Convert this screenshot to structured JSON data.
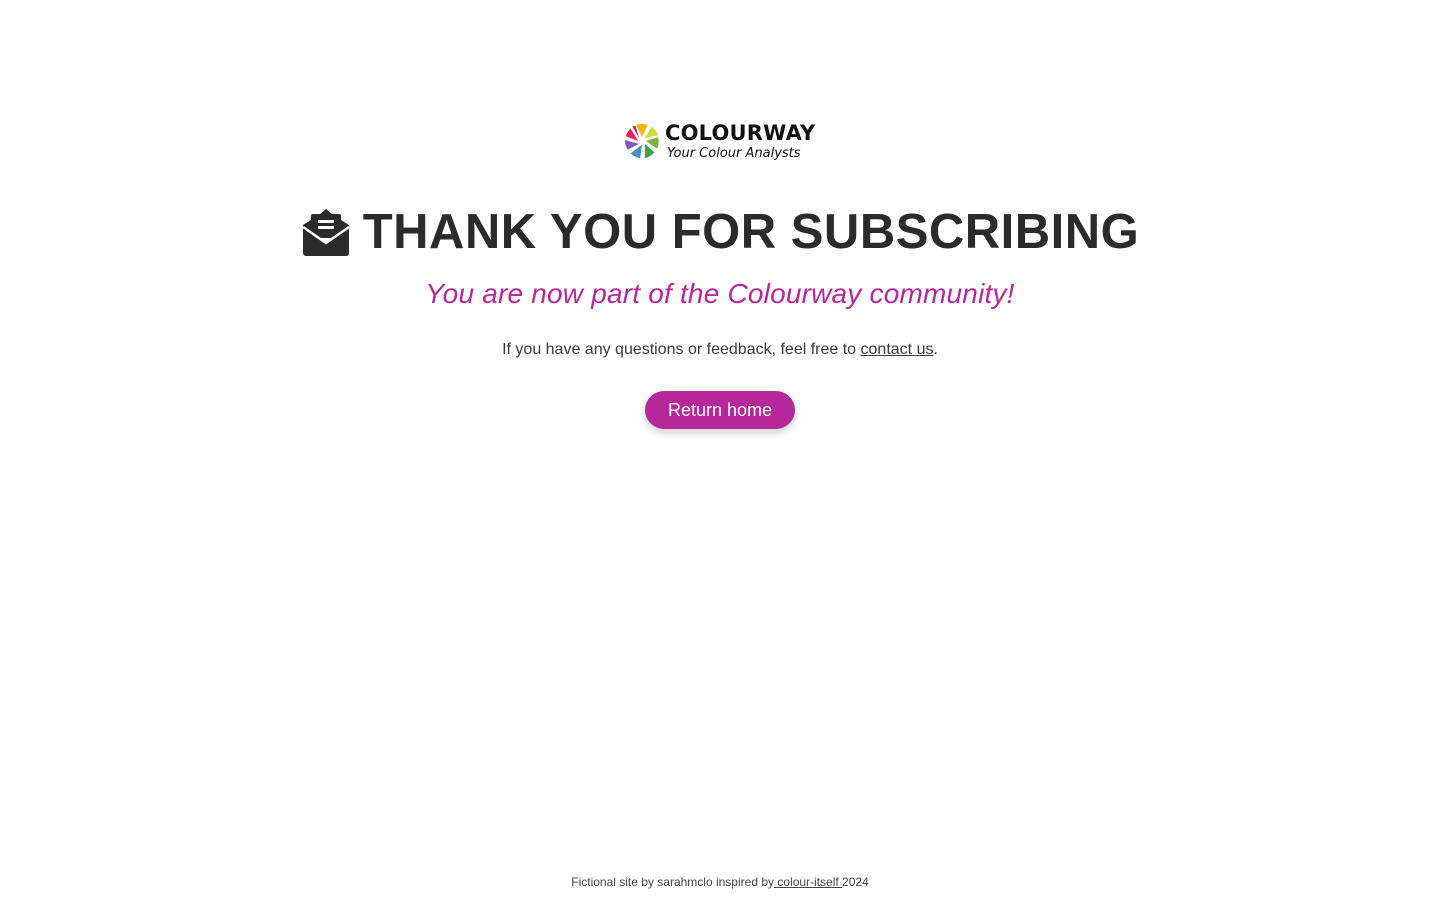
{
  "logo": {
    "name": "COLOURWAY",
    "tagline": "Your Colour Analysts",
    "wheel_colors": [
      "#e83e8c",
      "#c2185b",
      "#f4b400",
      "#cddc39",
      "#7cb342",
      "#43a047",
      "#4a90c2",
      "#7e57c2",
      "#e91e63"
    ]
  },
  "headline": {
    "icon": "envelope-open-text-icon",
    "text": "THANK YOU FOR SUBSCRIBING"
  },
  "subtitle": "You are now part of the Colourway community!",
  "note": {
    "prefix": "If you have any questions or feedback, feel free to ",
    "link_text": "contact us",
    "suffix": "."
  },
  "button": {
    "label": "Return home"
  },
  "footer": {
    "prefix": "Fictional site by sarahmclo inspired by",
    "link_text": " colour-itself ",
    "suffix": "2024"
  },
  "colors": {
    "accent": "#b5279b",
    "text": "#2b2b2b",
    "background": "#ffffff"
  }
}
